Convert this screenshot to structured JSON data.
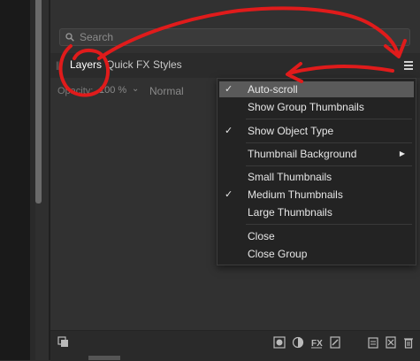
{
  "search": {
    "placeholder": "Search"
  },
  "tabs": [
    {
      "label": "Layers"
    },
    {
      "label": "Quick FX"
    },
    {
      "label": "Styles"
    }
  ],
  "toolbar": {
    "opacity_label": "Opacity:",
    "opacity_value": "100 %",
    "blend_mode": "Normal"
  },
  "context_menu": {
    "items": [
      {
        "label": "Auto-scroll",
        "checked": true,
        "highlighted": true
      },
      {
        "label": "Show Group Thumbnails",
        "checked": false
      },
      {
        "label": "Show Object Type",
        "checked": true
      },
      {
        "label": "Thumbnail Background",
        "checked": false,
        "submenu": true
      },
      {
        "label": "Small Thumbnails",
        "checked": false
      },
      {
        "label": "Medium Thumbnails",
        "checked": true
      },
      {
        "label": "Large Thumbnails",
        "checked": false
      },
      {
        "label": "Close",
        "checked": false
      },
      {
        "label": "Close Group",
        "checked": false
      }
    ]
  },
  "bottom_bar": {
    "icons": [
      "layers-stack-icon",
      "mask-icon",
      "adjustment-icon",
      "fx-icon",
      "brush-icon",
      "add-layer-icon",
      "duplicate-icon",
      "trash-icon"
    ]
  },
  "colors": {
    "panel_bg": "#313131",
    "menu_bg": "#232323",
    "menu_highlight": "#5a5a5a",
    "annotation_red": "#e01b1b"
  }
}
